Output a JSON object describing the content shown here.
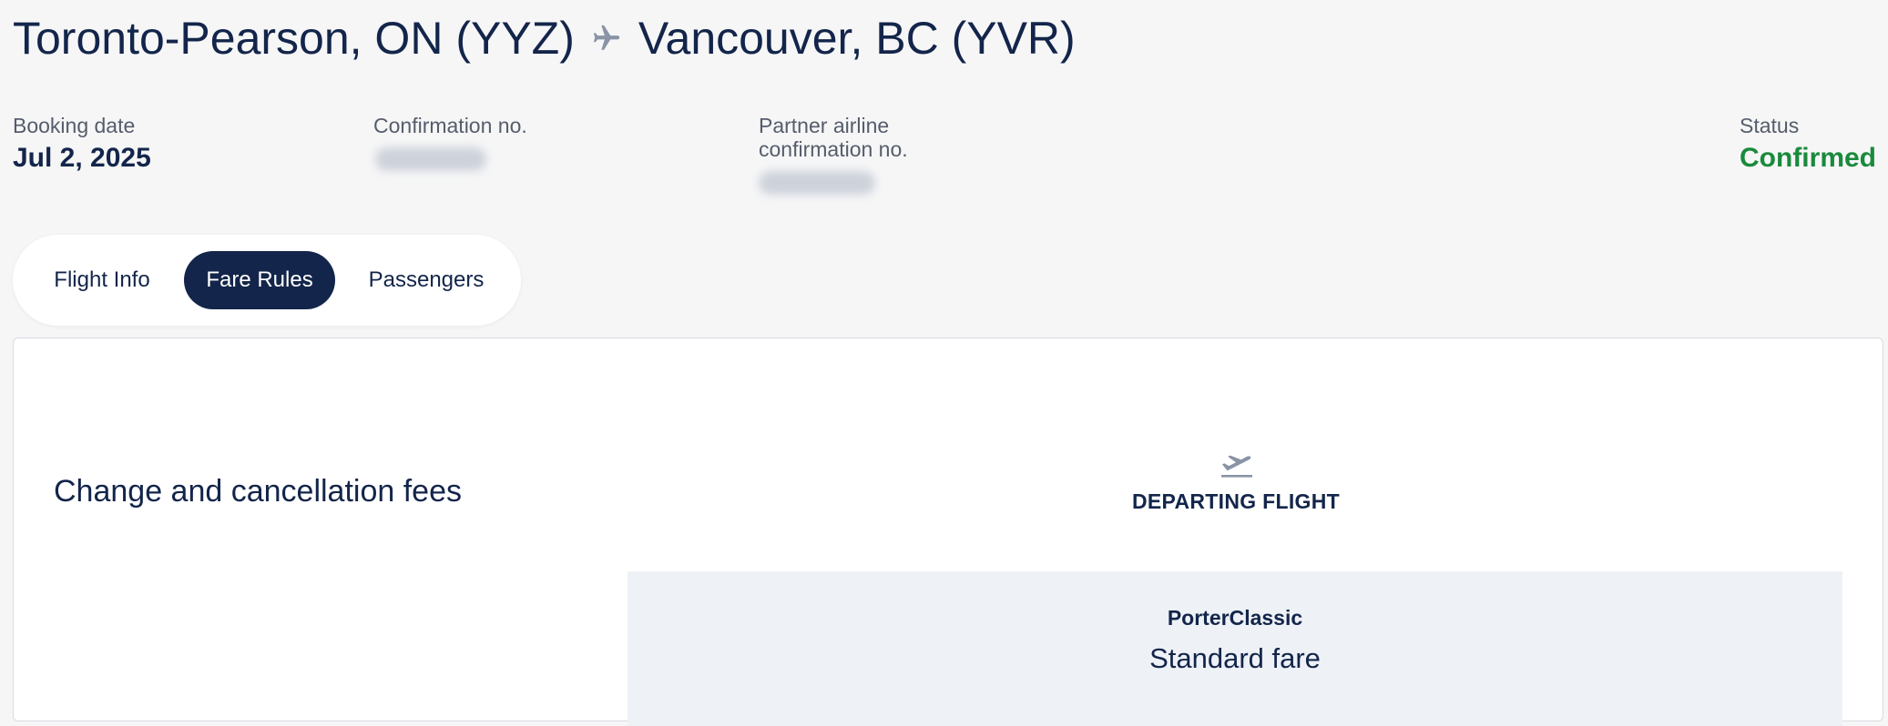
{
  "header": {
    "origin": "Toronto-Pearson, ON (YYZ)",
    "destination": "Vancouver, BC (YVR)",
    "route_icon": "airplane-icon"
  },
  "booking": {
    "booking_date_label": "Booking date",
    "booking_date_value": "Jul 2, 2025",
    "confirmation_label": "Confirmation no.",
    "partner_label_line1": "Partner airline",
    "partner_label_line2": "confirmation no.",
    "status_label": "Status",
    "status_value": "Confirmed",
    "status_color": "#1a8a3c"
  },
  "tabs": [
    {
      "label": "Flight Info",
      "active": false
    },
    {
      "label": "Fare Rules",
      "active": true
    },
    {
      "label": "Passengers",
      "active": false
    }
  ],
  "fare_rules": {
    "section_title": "Change and cancellation fees",
    "flight_icon": "departing-plane-icon",
    "flight_label": "DEPARTING FLIGHT",
    "fare_brand": "PorterClassic",
    "fare_type": "Standard fare"
  },
  "colors": {
    "primary": "#13254a",
    "success": "#1a8a3c",
    "page_bg": "#f6f6f7",
    "fare_bg": "#eef1f6"
  }
}
